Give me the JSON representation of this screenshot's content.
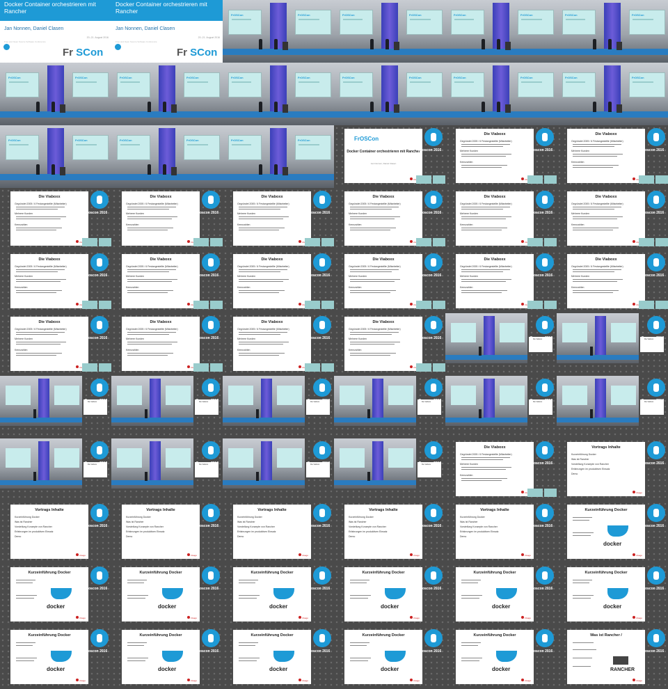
{
  "title_card": {
    "title": "Docker Container orchestrieren mit Rancher",
    "authors": "Jan Nonnen, Daniel Clasen",
    "date": "20.-21. August 2016",
    "subtitle": "Free and Open Source Software Conference",
    "logo_text_a": "Fr",
    "logo_text_b": "SCon"
  },
  "stage": {
    "pillar_text": "FrOSCon",
    "screen_text": "FrOSCon"
  },
  "slides": {
    "brand": "Froscon 2016",
    "company": "trivago",
    "intro_title": "Docker Container orchestrieren mit Rancher",
    "intro_logo": "FrOSCon",
    "intro_authors": "Jan Nonnen, Daniel Clasen",
    "viabox_title": "Die Viaboxx",
    "viabox_bullets": [
      "Gegründet 2005 / 6 Festangestellte (Mitarbeiter)",
      "Mehrere Kunden",
      "Kennzahlen"
    ],
    "agenda_title": "Vortrags Inhalte",
    "agenda_bullets": [
      "Kurzeinführung Docker",
      "Was ist Rancher",
      "Vorstellung Konzepte von Rancher",
      "Erfahrungen im produktiven Einsatz",
      "Demo"
    ],
    "docker_title": "Kurzeinführung Docker",
    "docker_logo": "docker",
    "rancher_title": "Was ist Rancher /",
    "rancher_logo": "RANCHER",
    "inset_slide_title": "Die Viaboxx"
  },
  "sequence": [
    "title",
    "title",
    "stage",
    "stage",
    "stage",
    "stage",
    "stage",
    "stage",
    "stage",
    "stage",
    "stage",
    "stage",
    "stage",
    "stage",
    "stage",
    "intro",
    "viabox",
    "viabox",
    "viabox",
    "viabox",
    "viabox",
    "viabox",
    "viabox",
    "viabox",
    "viabox",
    "viabox",
    "viabox",
    "viabox",
    "viabox",
    "viabox",
    "viabox",
    "viabox",
    "viabox",
    "viabox",
    "inset",
    "inset",
    "inset",
    "inset",
    "inset",
    "inset",
    "inset",
    "inset",
    "inset",
    "inset",
    "inset",
    "inset",
    "viabox",
    "agenda",
    "agenda",
    "agenda",
    "agenda",
    "agenda",
    "agenda",
    "docker",
    "docker",
    "docker",
    "docker",
    "docker",
    "docker",
    "docker",
    "docker",
    "docker",
    "docker",
    "docker",
    "docker",
    "rancher"
  ]
}
